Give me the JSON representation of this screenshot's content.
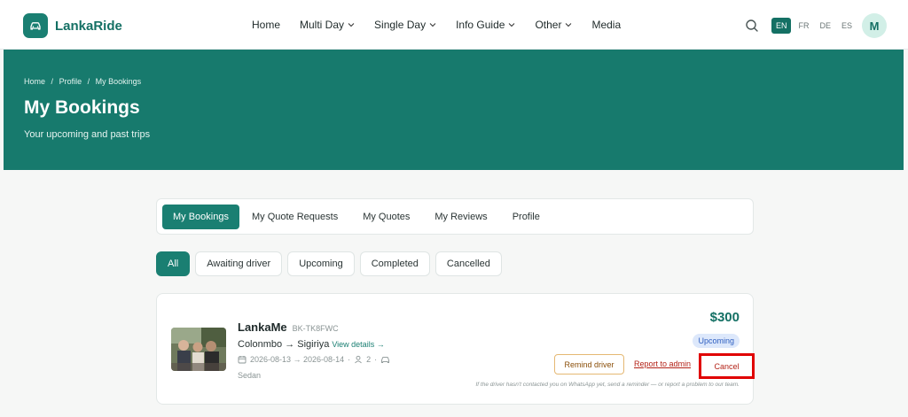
{
  "brand": {
    "name": "LankaRide",
    "logo_icon": "car-icon"
  },
  "nav": {
    "items": [
      {
        "label": "Home",
        "dropdown": false
      },
      {
        "label": "Multi Day",
        "dropdown": true
      },
      {
        "label": "Single Day",
        "dropdown": true
      },
      {
        "label": "Info Guide",
        "dropdown": true
      },
      {
        "label": "Other",
        "dropdown": true
      },
      {
        "label": "Media",
        "dropdown": false
      }
    ],
    "languages": [
      "EN",
      "FR",
      "DE",
      "ES"
    ],
    "active_language": "EN",
    "avatar_initial": "M"
  },
  "hero": {
    "breadcrumb": [
      "Home",
      "/",
      "Profile",
      "/",
      "My Bookings"
    ],
    "title": "My Bookings",
    "subtitle": "Your upcoming and past trips"
  },
  "tabs": [
    {
      "label": "My Bookings",
      "active": true
    },
    {
      "label": "My Quote Requests",
      "active": false
    },
    {
      "label": "My Quotes",
      "active": false
    },
    {
      "label": "My Reviews",
      "active": false
    },
    {
      "label": "Profile",
      "active": false
    }
  ],
  "filters": [
    {
      "label": "All",
      "active": true
    },
    {
      "label": "Awaiting driver",
      "active": false
    },
    {
      "label": "Upcoming",
      "active": false
    },
    {
      "label": "Completed",
      "active": false
    },
    {
      "label": "Cancelled",
      "active": false
    }
  ],
  "booking": {
    "driver_name": "LankaMe",
    "ref": "BK-TK8FWC",
    "route": "Colonmbo → Sigiriya",
    "view_details": "View details →",
    "dates": "2026-08-13 → 2026-08-14",
    "passengers": "2",
    "vehicle": "Sedan",
    "price": "$300",
    "status": "Upcoming",
    "remind_label": "Remind driver",
    "report_label": "Report to admin",
    "cancel_label": "Cancel",
    "note": "If the driver hasn't contacted you on WhatsApp yet, send a reminder — or report a problem to our team."
  },
  "colors": {
    "primary": "#1a7f72",
    "hero_bg": "#177a6d",
    "cancel_highlight": "#e00000",
    "status_blue": "#2f5fc0"
  }
}
